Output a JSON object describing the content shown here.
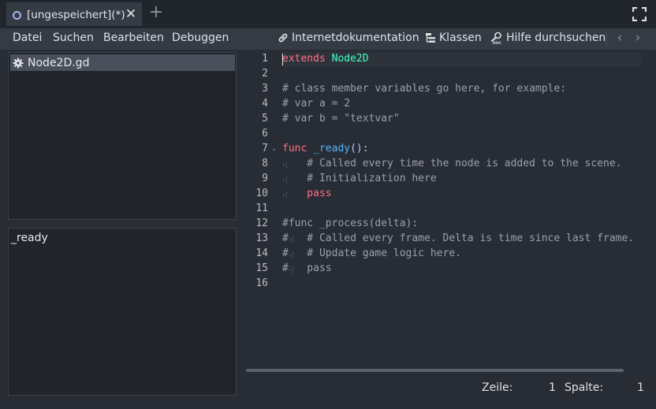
{
  "tab": {
    "title": "[ungespeichert](*)",
    "close": "✕",
    "add": "+"
  },
  "menu": {
    "items": [
      "Datei",
      "Suchen",
      "Bearbeiten",
      "Debuggen"
    ],
    "online_docs": "Internetdokumentation",
    "classes": "Klassen",
    "search_help": "Hilfe durchsuchen",
    "back": "‹",
    "forward": "›"
  },
  "scripts": {
    "items": [
      {
        "label": "Node2D.gd",
        "icon": "gear-icon"
      }
    ]
  },
  "methods": {
    "items": [
      "_ready"
    ]
  },
  "editor": {
    "lines": [
      {
        "n": "1",
        "tokens": [
          [
            "kw",
            "extends"
          ],
          [
            "",
            ""
          ],
          [
            "ty",
            " Node2D"
          ]
        ]
      },
      {
        "n": "2",
        "tokens": []
      },
      {
        "n": "3",
        "tokens": [
          [
            "cm",
            "# class member variables go here, for example:"
          ]
        ]
      },
      {
        "n": "4",
        "tokens": [
          [
            "cm",
            "# var a = 2"
          ]
        ]
      },
      {
        "n": "5",
        "tokens": [
          [
            "cm",
            "# var b = \"textvar\""
          ]
        ]
      },
      {
        "n": "6",
        "tokens": []
      },
      {
        "n": "7",
        "tokens": [
          [
            "kw",
            "func"
          ],
          [
            "fn",
            " _ready"
          ],
          [
            "sy",
            "():"
          ]
        ]
      },
      {
        "n": "8",
        "tokens": [
          [
            "cm",
            "    # Called every time the node is added to the scene."
          ]
        ]
      },
      {
        "n": "9",
        "tokens": [
          [
            "cm",
            "    # Initialization here"
          ]
        ]
      },
      {
        "n": "10",
        "tokens": [
          [
            "kw",
            "    pass"
          ]
        ]
      },
      {
        "n": "11",
        "tokens": []
      },
      {
        "n": "12",
        "tokens": [
          [
            "cm",
            "#func _process(delta):"
          ]
        ]
      },
      {
        "n": "13",
        "tokens": [
          [
            "cm",
            "#   # Called every frame. Delta is time since last frame."
          ]
        ]
      },
      {
        "n": "14",
        "tokens": [
          [
            "cm",
            "#   # Update game logic here."
          ]
        ]
      },
      {
        "n": "15",
        "tokens": [
          [
            "cm",
            "#   pass"
          ]
        ]
      },
      {
        "n": "16",
        "tokens": []
      }
    ]
  },
  "status": {
    "line_label": "Zeile:",
    "line_value": "1",
    "col_label": "Spalte:",
    "col_value": "1"
  },
  "colors": {
    "keyword": "#ff7085",
    "type": "#42ffc2",
    "comment": "#9aa0aa",
    "function": "#57b3ff",
    "symbol": "#abc8ff"
  }
}
